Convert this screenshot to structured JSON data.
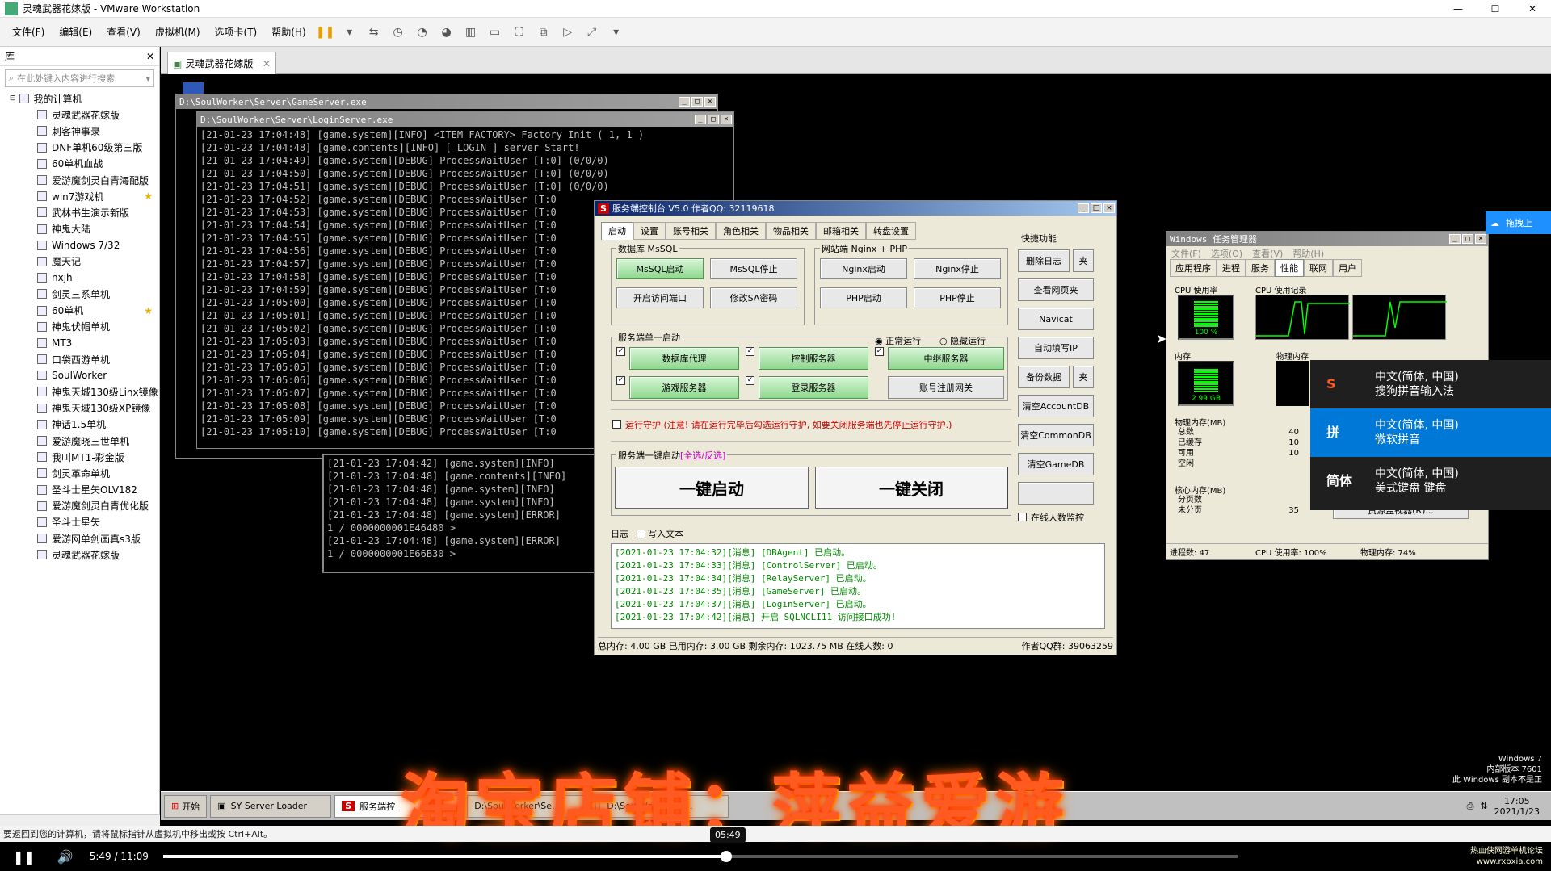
{
  "window": {
    "title": "灵魂武器花嫁版 - VMware Workstation",
    "controls": [
      "—",
      "☐",
      "✕"
    ]
  },
  "menu": [
    "文件(F)",
    "编辑(E)",
    "查看(V)",
    "虚拟机(M)",
    "选项卡(T)",
    "帮助(H)"
  ],
  "library": {
    "title": "库",
    "search_placeholder": "在此处键入内容进行搜索",
    "root": "我的计算机",
    "items": [
      {
        "label": "灵魂武器花嫁版",
        "star": false
      },
      {
        "label": "刺客神事录",
        "star": false
      },
      {
        "label": "DNF单机60级第三版",
        "star": false
      },
      {
        "label": "60单机血战",
        "star": false
      },
      {
        "label": "爱游魔剑灵白青海配版",
        "star": false
      },
      {
        "label": "win7游戏机",
        "star": true
      },
      {
        "label": "武林书生演示新版",
        "star": false
      },
      {
        "label": "神鬼大陆",
        "star": false
      },
      {
        "label": "Windows 7/32",
        "star": false
      },
      {
        "label": "魔天记",
        "star": false
      },
      {
        "label": "nxjh",
        "star": false
      },
      {
        "label": "剑灵三系单机",
        "star": false
      },
      {
        "label": "60单机",
        "star": true
      },
      {
        "label": "神鬼伏帽单机",
        "star": false
      },
      {
        "label": "MT3",
        "star": false
      },
      {
        "label": "口袋西游单机",
        "star": false
      },
      {
        "label": "SoulWorker",
        "star": false
      },
      {
        "label": "神鬼天城130级Linx镜像",
        "star": false
      },
      {
        "label": "神鬼天域130级XP镜像",
        "star": false
      },
      {
        "label": "神话1.5单机",
        "star": false
      },
      {
        "label": "爱游魔晓三世单机",
        "star": false
      },
      {
        "label": "我叫MT1-彩金版",
        "star": false
      },
      {
        "label": "剑灵革命单机",
        "star": false
      },
      {
        "label": "圣斗士星矢OLV182",
        "star": false
      },
      {
        "label": "爱游魔剑灵白青优化版",
        "star": false
      },
      {
        "label": "圣斗士星矢",
        "star": false
      },
      {
        "label": "爱游网单剑画真s3版",
        "star": false
      },
      {
        "label": "灵魂武器花嫁版",
        "star": false
      }
    ]
  },
  "vm_tab": "灵魂武器花嫁版",
  "gameserver": {
    "title": "D:\\SoulWorker\\Server\\GameServer.exe"
  },
  "loginserver": {
    "title": "D:\\SoulWorker\\Server\\LoginServer.exe",
    "lines": [
      "[21-01-23 17:04:48] [game.system][INFO] <ITEM_FACTORY> Factory Init ( 1, 1 )",
      "[21-01-23 17:04:48] [game.contents][INFO] [ LOGIN ] server Start!",
      "[21-01-23 17:04:49] [game.system][DEBUG] ProcessWaitUser [T:0] (0/0/0)",
      "[21-01-23 17:04:50] [game.system][DEBUG] ProcessWaitUser [T:0] (0/0/0)",
      "[21-01-23 17:04:51] [game.system][DEBUG] ProcessWaitUser [T:0] (0/0/0)",
      "[21-01-23 17:04:52] [game.system][DEBUG] ProcessWaitUser [T:0",
      "[21-01-23 17:04:53] [game.system][DEBUG] ProcessWaitUser [T:0",
      "[21-01-23 17:04:54] [game.system][DEBUG] ProcessWaitUser [T:0",
      "[21-01-23 17:04:55] [game.system][DEBUG] ProcessWaitUser [T:0",
      "[21-01-23 17:04:56] [game.system][DEBUG] ProcessWaitUser [T:0",
      "[21-01-23 17:04:57] [game.system][DEBUG] ProcessWaitUser [T:0",
      "[21-01-23 17:04:58] [game.system][DEBUG] ProcessWaitUser [T:0",
      "[21-01-23 17:04:59] [game.system][DEBUG] ProcessWaitUser [T:0",
      "[21-01-23 17:05:00] [game.system][DEBUG] ProcessWaitUser [T:0",
      "[21-01-23 17:05:01] [game.system][DEBUG] ProcessWaitUser [T:0",
      "[21-01-23 17:05:02] [game.system][DEBUG] ProcessWaitUser [T:0",
      "[21-01-23 17:05:03] [game.system][DEBUG] ProcessWaitUser [T:0",
      "[21-01-23 17:05:04] [game.system][DEBUG] ProcessWaitUser [T:0",
      "[21-01-23 17:05:05] [game.system][DEBUG] ProcessWaitUser [T:0",
      "[21-01-23 17:05:06] [game.system][DEBUG] ProcessWaitUser [T:0",
      "[21-01-23 17:05:07] [game.system][DEBUG] ProcessWaitUser [T:0",
      "[21-01-23 17:05:08] [game.system][DEBUG] ProcessWaitUser [T:0",
      "[21-01-23 17:05:09] [game.system][DEBUG] ProcessWaitUser [T:0",
      "[21-01-23 17:05:10] [game.system][DEBUG] ProcessWaitUser [T:0"
    ]
  },
  "back_console": {
    "lines": [
      "[21-01-23 17:04:42] [game.system][INFO]",
      "[21-01-23 17:04:48] [game.contents][INFO]",
      "[21-01-23 17:04:48] [game.system][INFO]",
      "[21-01-23 17:04:48] [game.system][INFO]",
      "[21-01-23 17:04:48] [game.system][ERROR]",
      "1 / 0000000001E46480 >",
      "[21-01-23 17:04:48] [game.system][ERROR]",
      "1 / 0000000001E66B30 >"
    ]
  },
  "control": {
    "title": "服务端控制台 V5.0  作者QQ: 32119618",
    "tabs": [
      "启动",
      "设置",
      "账号相关",
      "角色相关",
      "物品相关",
      "邮箱相关",
      "转盘设置"
    ],
    "db_group": "数据库 MsSQL",
    "db_buttons": [
      "MsSQL启动",
      "MsSQL停止",
      "开启访问端口",
      "修改SA密码"
    ],
    "web_group": "网站端 Nginx + PHP",
    "web_buttons": [
      "Nginx启动",
      "Nginx停止",
      "PHP启动",
      "PHP停止"
    ],
    "single_group": "服务端单一启动",
    "mode_normal": "正常运行",
    "mode_hidden": "隐藏运行",
    "services": [
      "数据库代理",
      "控制服务器",
      "中继服务器",
      "游戏服务器",
      "登录服务器",
      "账号注册网关"
    ],
    "guard_text": "运行守护 (注意! 请在运行完毕后勾选运行守护, 如要关闭服务端也先停止运行守护.)",
    "oneclick_group": "服务端一键启动",
    "oneclick_link": "[全选/反选]",
    "start_all": "一键启动",
    "stop_all": "一键关闭",
    "quick_group": "快捷功能",
    "quick_buttons": [
      "删除日志",
      "查看网页夹",
      "Navicat",
      "自动填写IP",
      "备份数据",
      "清空AccountDB",
      "清空CommonDB",
      "清空GameDB",
      ""
    ],
    "quick_small": [
      "夹",
      "夹"
    ],
    "online_monitor": "在线人数监控",
    "log_label": "日志",
    "write_text": "写入文本",
    "log_lines": [
      "[2021-01-23 17:04:32][消息] [DBAgent] 已启动。",
      "[2021-01-23 17:04:33][消息] [ControlServer] 已启动。",
      "[2021-01-23 17:04:34][消息] [RelayServer] 已启动。",
      "[2021-01-23 17:04:35][消息] [GameServer] 已启动。",
      "[2021-01-23 17:04:37][消息] [LoginServer] 已启动。",
      "[2021-01-23 17:04:42][消息] 开启_SQLNCLI11_访问接口成功!"
    ],
    "status": "总内存: 4.00 GB  已用内存: 3.00 GB  剩余内存: 1023.75 MB  在线人数: 0",
    "status_right": "作者QQ群: 39063259"
  },
  "taskmgr": {
    "title": "Windows 任务管理器",
    "menu": [
      "文件(F)",
      "选项(O)",
      "查看(V)",
      "帮助(H)"
    ],
    "tabs": [
      "应用程序",
      "进程",
      "服务",
      "性能",
      "联网",
      "用户"
    ],
    "cpu_usage_label": "CPU 使用率",
    "cpu_history_label": "CPU 使用记录",
    "cpu_value": "100 %",
    "mem_label": "内存",
    "mem_value": "2.99 GB",
    "phys_history_label": "物理内存",
    "phys_mem_label": "物理内存(MB)",
    "phys_rows": [
      "总数",
      "已缓存",
      "可用",
      "空闲"
    ],
    "phys_vals": [
      "40",
      "10",
      "10",
      ""
    ],
    "kernel_label": "核心内存(MB)",
    "kernel_rows": [
      "分页数",
      "未分页"
    ],
    "kernel_vals": [
      "",
      "35"
    ],
    "resmon_button": "资源监视器(R)...",
    "status": [
      "进程数: 47",
      "CPU 使用率: 100%",
      "物理内存: 74%"
    ]
  },
  "ime": {
    "items": [
      {
        "badge": "S",
        "line1": "中文(简体, 中国)",
        "line2": "搜狗拼音输入法",
        "selected": false
      },
      {
        "badge": "拼",
        "line1": "中文(简体, 中国)",
        "line2": "微软拼音",
        "selected": true
      },
      {
        "badge": "简体",
        "line1": "中文(简体, 中国)",
        "line2": "美式键盘 键盘",
        "selected": false
      }
    ]
  },
  "cloud_label": "拖拽上",
  "desktop_note": [
    "Windows 7",
    "内部版本 7601",
    "此 Windows 副本不是正"
  ],
  "guest_taskbar": {
    "start": "开始",
    "items": [
      "SY Server Loader",
      "服务端控",
      "D:\\SoulWorker\\Se...",
      "D:\\SoulWorker\\Se..."
    ],
    "clock_time": "17:05",
    "clock_date": "2021/1/23"
  },
  "overlay_text": "淘宝店铺：萍益爱游",
  "vm_status": "要返回到您的计算机，请将鼠标指针从虚拟机中移出或按 Ctrl+Alt。",
  "player": {
    "current": "5:49",
    "total": "11:09",
    "tooltip": "05:49",
    "progress": 0.524
  },
  "watermark": [
    "热血侠网游单机论坛",
    "www.rxbxia.com"
  ]
}
